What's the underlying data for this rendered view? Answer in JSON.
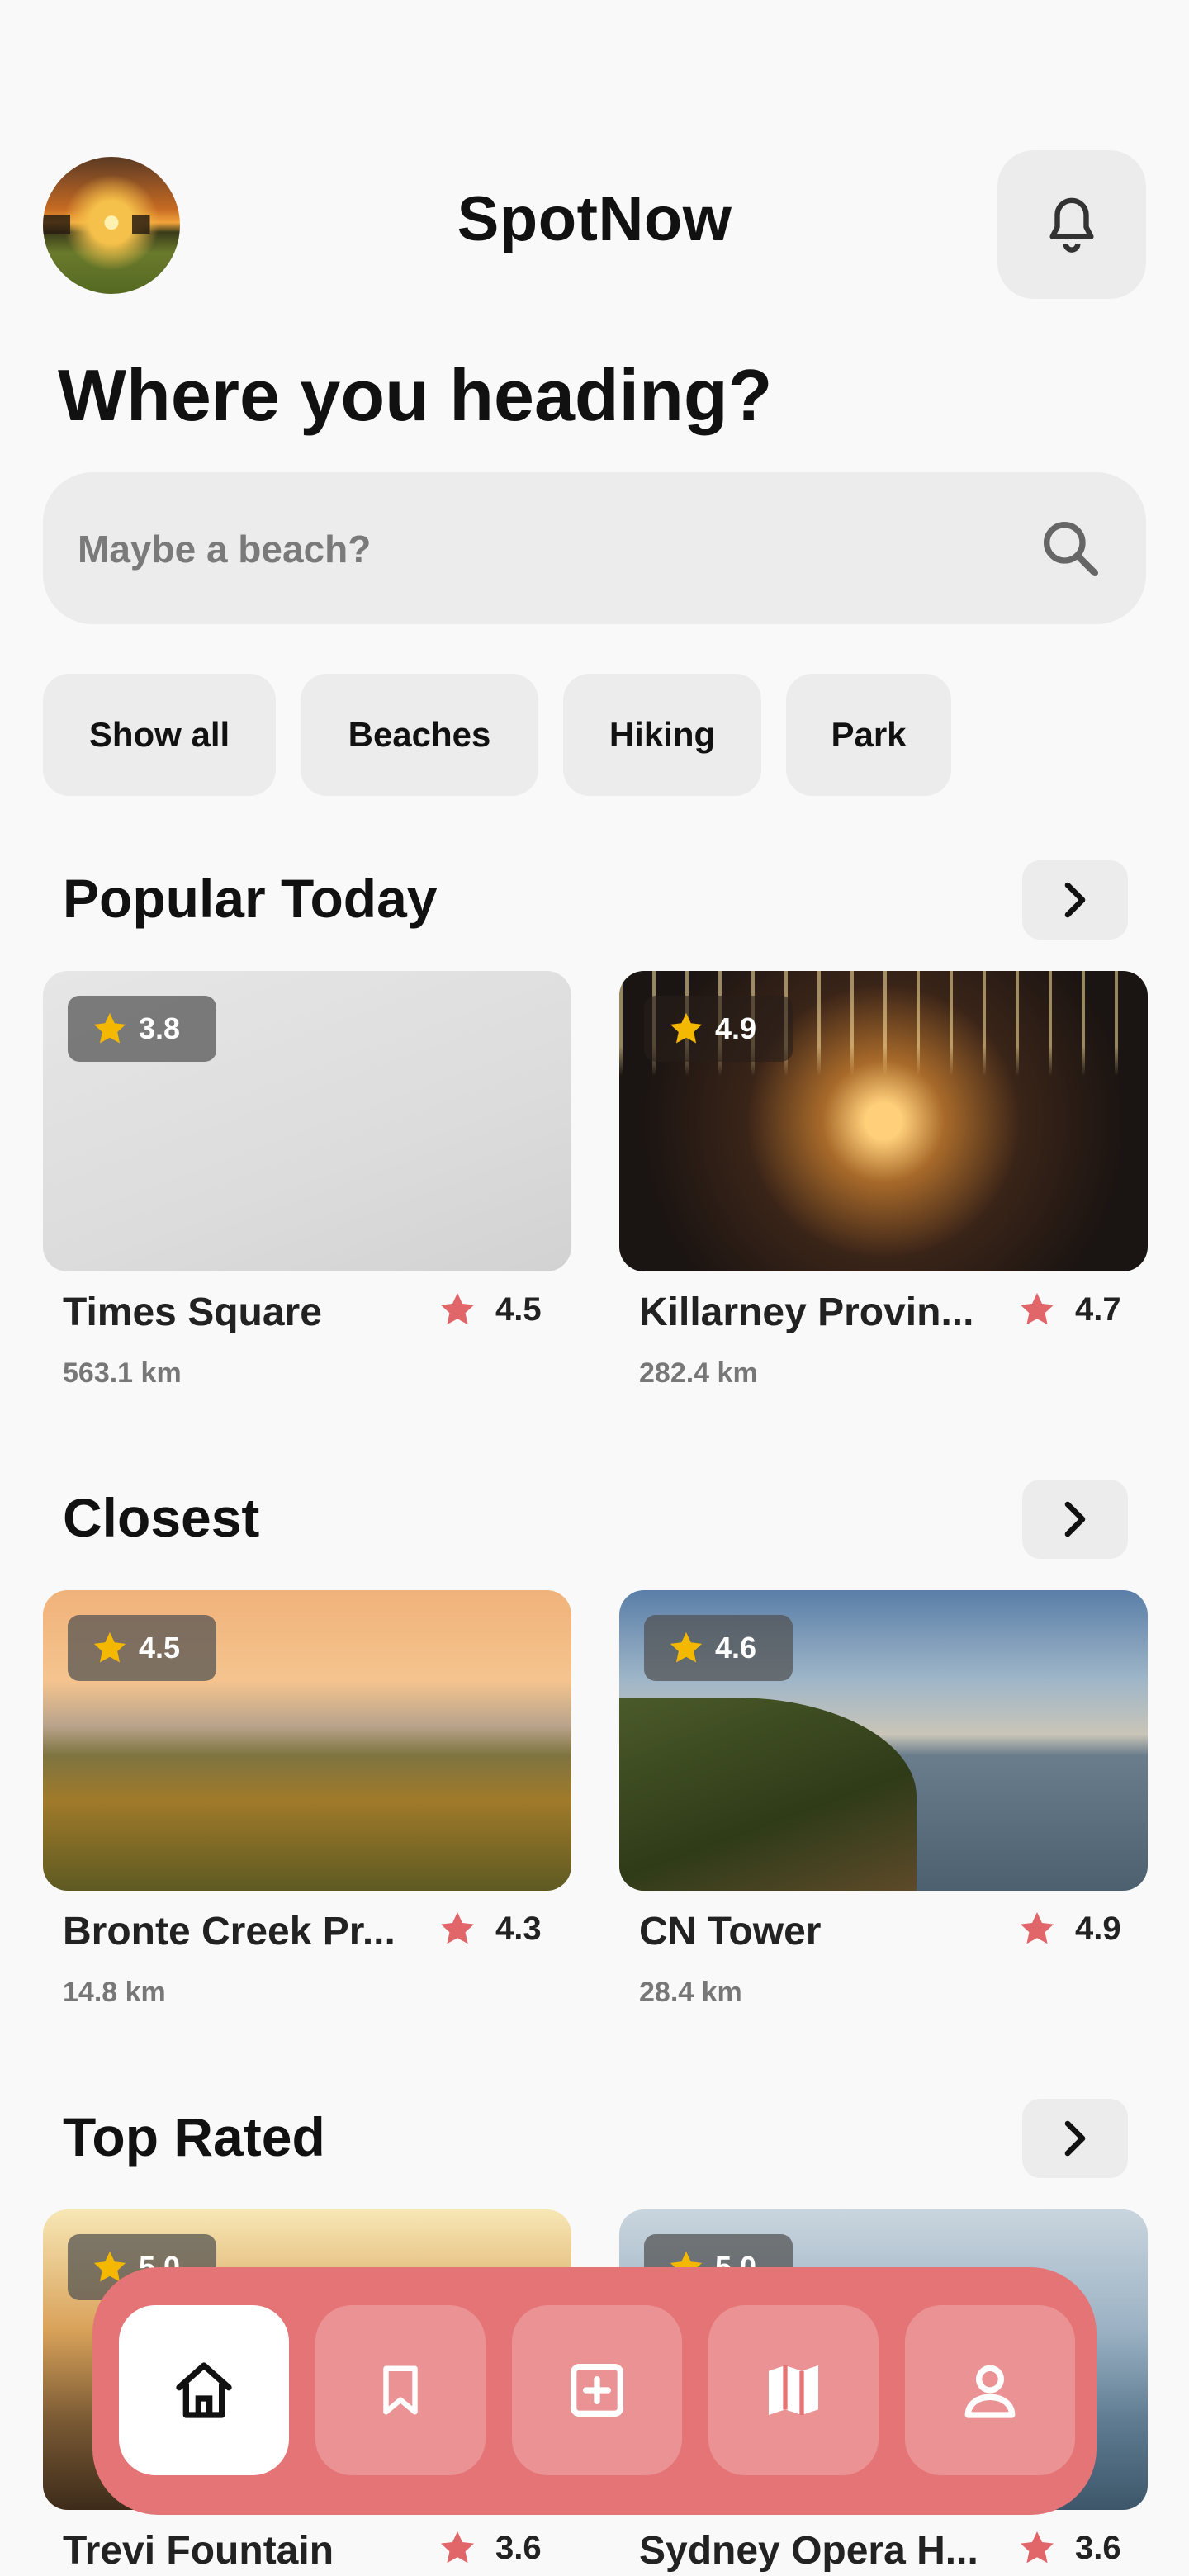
{
  "app": {
    "title": "SpotNow"
  },
  "header": {
    "heading": "Where you heading?"
  },
  "search": {
    "placeholder": "Maybe a beach?"
  },
  "filters": [
    "Show all",
    "Beaches",
    "Hiking",
    "Park"
  ],
  "sections": [
    {
      "title": "Popular Today",
      "cards": [
        {
          "badge_rating": "3.8",
          "name": "Times Square",
          "rating": "4.5",
          "distance": "563.1 km"
        },
        {
          "badge_rating": "4.9",
          "name": "Killarney Provin...",
          "rating": "4.7",
          "distance": "282.4 km"
        }
      ]
    },
    {
      "title": "Closest",
      "cards": [
        {
          "badge_rating": "4.5",
          "name": "Bronte Creek Pr...",
          "rating": "4.3",
          "distance": "14.8 km"
        },
        {
          "badge_rating": "4.6",
          "name": "CN Tower",
          "rating": "4.9",
          "distance": "28.4 km"
        }
      ]
    },
    {
      "title": "Top Rated",
      "cards": [
        {
          "badge_rating": "5.0",
          "name": "Trevi Fountain",
          "rating": "3.6"
        },
        {
          "badge_rating": "5.0",
          "name": "Sydney Opera H...",
          "rating": "3.6"
        }
      ]
    }
  ],
  "nav": {
    "items": [
      "home-icon",
      "bookmark-icon",
      "add-square-icon",
      "map-icon",
      "profile-icon"
    ],
    "active": "home-icon"
  },
  "colors": {
    "accent": "#e57476",
    "star_badge": "#f5b800",
    "star_rating": "#e0666a",
    "chip_bg": "#ececec"
  }
}
